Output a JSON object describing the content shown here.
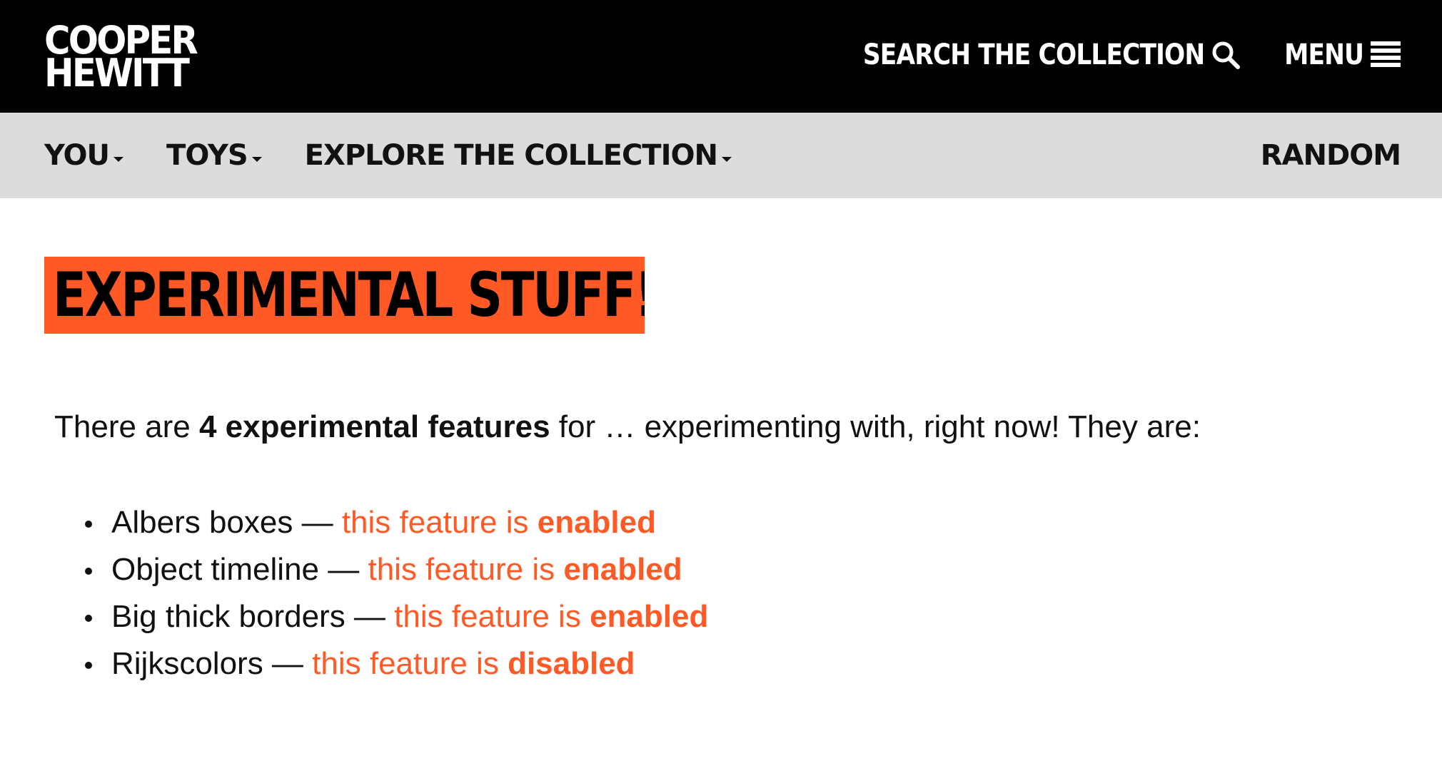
{
  "brand": {
    "logo_line1": "COOPER",
    "logo_line2": "HEWITT"
  },
  "header": {
    "search_label": "SEARCH THE COLLECTION",
    "search_icon": "search-icon",
    "menu_label": "MENU",
    "menu_icon": "hamburger-icon"
  },
  "subnav": {
    "items": [
      {
        "label": "YOU"
      },
      {
        "label": "TOYS"
      },
      {
        "label": "EXPLORE THE COLLECTION"
      }
    ],
    "random_label": "RANDOM"
  },
  "main": {
    "title": "EXPERIMENTAL STUFF!",
    "intro_before": "There are ",
    "intro_bold": "4 experimental features",
    "intro_after": " for … experimenting with, right now! They are:",
    "features": [
      {
        "name": "Albers boxes",
        "dash": " — ",
        "status_prefix": "this feature is ",
        "status": "enabled"
      },
      {
        "name": "Object timeline",
        "dash": " — ",
        "status_prefix": "this feature is ",
        "status": "enabled"
      },
      {
        "name": "Big thick borders",
        "dash": " — ",
        "status_prefix": "this feature is ",
        "status": "enabled"
      },
      {
        "name": "Rijkscolors",
        "dash": " — ",
        "status_prefix": "this feature is ",
        "status": "disabled"
      }
    ]
  },
  "colors": {
    "accent": "#ff5a26",
    "header_bg": "#000000",
    "subnav_bg": "#dcdcdc"
  }
}
